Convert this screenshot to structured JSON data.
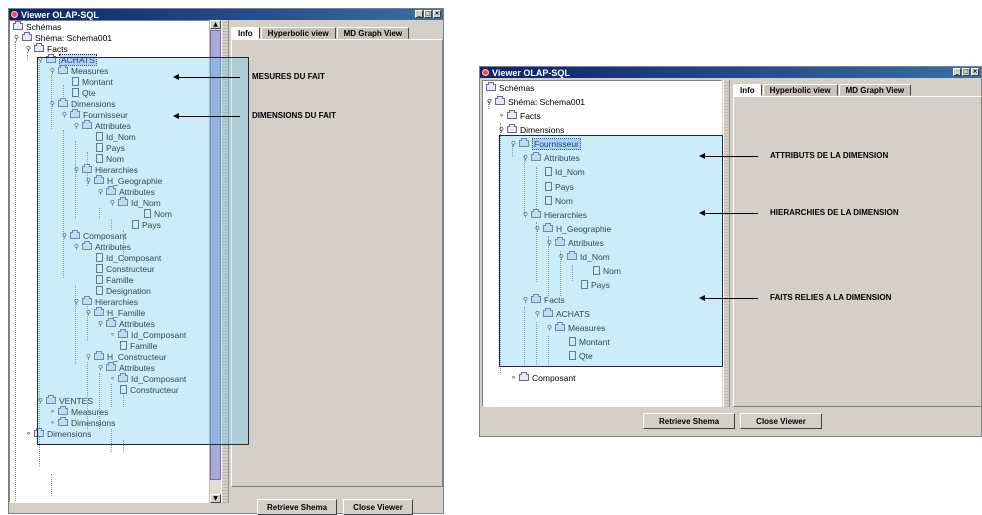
{
  "left_window": {
    "title": "Viewer OLAP-SQL",
    "tabs": [
      "Info",
      "Hyperbolic view",
      "MD Graph View"
    ],
    "buttons": {
      "retrieve": "Retrieve Shema",
      "close": "Close Viewer"
    },
    "tree": [
      "Schémas",
      "Shéma: Schema001",
      "Facts",
      "ACHATS",
      "Measures",
      "Montant",
      "Qte",
      "Dimensions",
      "Fournisseur",
      "Attributes",
      "Id_Nom",
      "Pays",
      "Nom",
      "Hierarchies",
      "H_Geographie",
      "Attributes",
      "Id_Nom",
      "Nom",
      "Pays",
      "Composant",
      "Attributes",
      "Id_Composant",
      "Constructeur",
      "Famille",
      "Designation",
      "Hierarchies",
      "H_Famille",
      "Attributes",
      "Id_Composant",
      "Famille",
      "H_Constructeur",
      "Attributes",
      "Id_Composant",
      "Constructeur",
      "VENTES",
      "Measures",
      "Dimensions",
      "Dimensions"
    ],
    "annotations": [
      "MESURES DU FAIT",
      "DIMENSIONS DU FAIT"
    ]
  },
  "right_window": {
    "title": "Viewer OLAP-SQL",
    "tabs": [
      "Info",
      "Hyperbolic view",
      "MD Graph View"
    ],
    "buttons": {
      "retrieve": "Retrieve Shema",
      "close": "Close Viewer"
    },
    "tree": [
      "Schémas",
      "Shéma: Schema001",
      "Facts",
      "Dimensions",
      "Fournisseur",
      "Attributes",
      "Id_Nom",
      "Pays",
      "Nom",
      "Hierarchies",
      "H_Geographie",
      "Attributes",
      "Id_Nom",
      "Nom",
      "Pays",
      "Facts",
      "ACHATS",
      "Measures",
      "Montant",
      "Qte",
      "Composant"
    ],
    "annotations": [
      "ATTRIBUTS DE LA DIMENSION",
      "HIERARCHIES DE LA DIMENSION",
      "FAITS RELIES A LA DIMENSION"
    ]
  }
}
